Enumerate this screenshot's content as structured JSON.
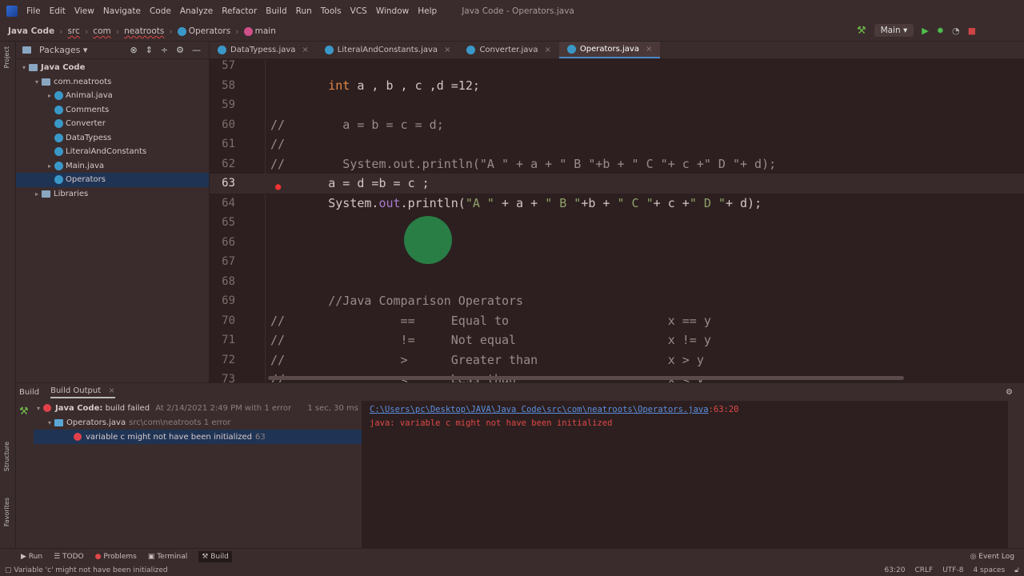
{
  "menu": [
    "File",
    "Edit",
    "View",
    "Navigate",
    "Code",
    "Analyze",
    "Refactor",
    "Build",
    "Run",
    "Tools",
    "VCS",
    "Window",
    "Help"
  ],
  "window_title": "Java Code - Operators.java",
  "breadcrumb": [
    "Java Code",
    "src",
    "com",
    "neatroots",
    "Operators",
    "main"
  ],
  "run_config": "Main",
  "project": {
    "view_label": "Packages",
    "tree": [
      {
        "label": "Java Code",
        "indent": 0,
        "arrow": "▾",
        "bold": true
      },
      {
        "label": "com.neatroots",
        "indent": 1,
        "arrow": "▾"
      },
      {
        "label": "Animal.java",
        "indent": 2,
        "arrow": "▸"
      },
      {
        "label": "Comments",
        "indent": 2,
        "arrow": ""
      },
      {
        "label": "Converter",
        "indent": 2,
        "arrow": ""
      },
      {
        "label": "DataTypess",
        "indent": 2,
        "arrow": ""
      },
      {
        "label": "LiteralAndConstants",
        "indent": 2,
        "arrow": ""
      },
      {
        "label": "Main.java",
        "indent": 2,
        "arrow": "▸"
      },
      {
        "label": "Operators",
        "indent": 2,
        "arrow": "",
        "selected": true
      },
      {
        "label": "Libraries",
        "indent": 1,
        "arrow": "▸"
      }
    ]
  },
  "tabs": [
    {
      "label": "DataTypess.java"
    },
    {
      "label": "LiteralAndConstants.java"
    },
    {
      "label": "Converter.java"
    },
    {
      "label": "Operators.java",
      "active": true
    }
  ],
  "code_lines": [
    {
      "n": "57",
      "t": []
    },
    {
      "n": "58",
      "t": [
        [
          "        ",
          ""
        ],
        [
          "int",
          "kw"
        ],
        [
          " a , b , c ,d =12;",
          ""
        ]
      ]
    },
    {
      "n": "59",
      "t": []
    },
    {
      "n": "60",
      "t": [
        [
          "//        a = b = c = d;",
          "cm"
        ]
      ]
    },
    {
      "n": "61",
      "t": [
        [
          "//",
          "cm"
        ]
      ]
    },
    {
      "n": "62",
      "t": [
        [
          "//        System.out.println(\"A \" + a + \" B \"+b + \" C \"+ c +\" D \"+ d);",
          "cm"
        ]
      ]
    },
    {
      "n": "63",
      "t": [
        [
          "        a = d =b = c ;",
          ""
        ]
      ],
      "current": true,
      "bulb": true
    },
    {
      "n": "64",
      "t": [
        [
          "        System.",
          ""
        ],
        [
          "out",
          "fld"
        ],
        [
          ".println(",
          ""
        ],
        [
          "\"A \"",
          "str"
        ],
        [
          " + a + ",
          ""
        ],
        [
          "\" B \"",
          "str"
        ],
        [
          "+b + ",
          ""
        ],
        [
          "\" C \"",
          "str"
        ],
        [
          "+ c +",
          ""
        ],
        [
          "\" D \"",
          "str"
        ],
        [
          "+ d);",
          ""
        ]
      ]
    },
    {
      "n": "65",
      "t": []
    },
    {
      "n": "66",
      "t": []
    },
    {
      "n": "67",
      "t": []
    },
    {
      "n": "68",
      "t": []
    },
    {
      "n": "69",
      "t": [
        [
          "        //Java Comparison Operators",
          "cm"
        ]
      ]
    },
    {
      "n": "70",
      "t": [
        [
          "//                ==     Equal to                      x == y",
          "cm"
        ]
      ]
    },
    {
      "n": "71",
      "t": [
        [
          "//                !=     Not equal                     x != y",
          "cm"
        ]
      ]
    },
    {
      "n": "72",
      "t": [
        [
          "//                >      Greater than                  x > y",
          "cm"
        ]
      ]
    },
    {
      "n": "73",
      "t": [
        [
          "//                <      Less than                     x < y",
          "cm"
        ]
      ]
    }
  ],
  "build": {
    "tabs": [
      "Build",
      "Build Output"
    ],
    "root": {
      "name": "Java Code:",
      "status": "build failed",
      "detail": "At 2/14/2021 2:49 PM with 1 error",
      "time": "1 sec, 30 ms"
    },
    "file": {
      "name": "Operators.java",
      "detail": "src\\com\\neatroots 1 error"
    },
    "error": {
      "message": "variable c might not have been initialized",
      "line": "63"
    },
    "console_link": "C:\\Users\\pc\\Desktop\\JAVA\\Java Code\\src\\com\\neatroots\\Operators.java",
    "console_pos": ":63:20",
    "console_error": "java: variable c might not have been initialized"
  },
  "toolwindows": [
    "Run",
    "TODO",
    "Problems",
    "Terminal",
    "Build"
  ],
  "event_log": "Event Log",
  "status": {
    "message": "Variable 'c' might not have been initialized",
    "position": "63:20",
    "line_sep": "CRLF",
    "encoding": "UTF-8",
    "indent": "4 spaces"
  },
  "side_tabs": [
    "Project",
    "Structure",
    "Favorites"
  ]
}
